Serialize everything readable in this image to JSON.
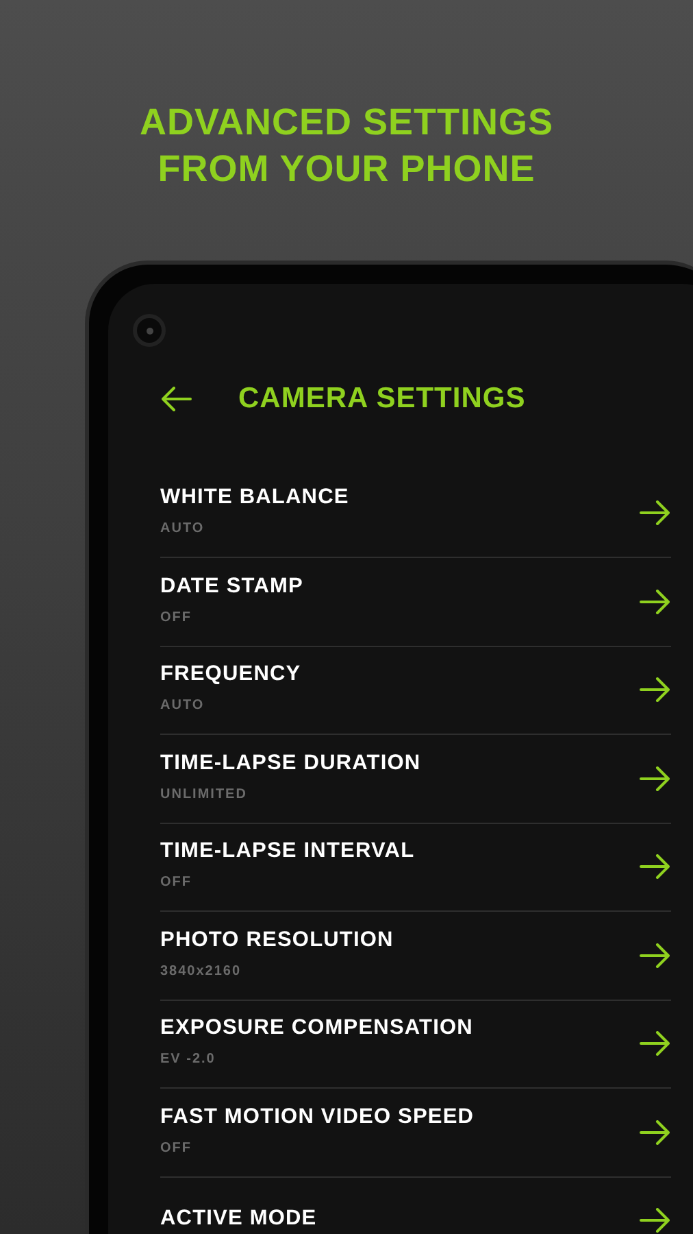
{
  "headline": [
    "ADVANCED SETTINGS",
    "FROM YOUR PHONE"
  ],
  "screen": {
    "title": "CAMERA SETTINGS",
    "items": [
      {
        "title": "WHITE BALANCE",
        "value": "AUTO"
      },
      {
        "title": "DATE STAMP",
        "value": "OFF"
      },
      {
        "title": "FREQUENCY",
        "value": "AUTO"
      },
      {
        "title": "TIME-LAPSE DURATION",
        "value": "UNLIMITED"
      },
      {
        "title": "TIME-LAPSE INTERVAL",
        "value": "OFF"
      },
      {
        "title": "PHOTO RESOLUTION",
        "value": "3840x2160"
      },
      {
        "title": "EXPOSURE COMPENSATION",
        "value": "EV -2.0"
      },
      {
        "title": "FAST MOTION VIDEO SPEED",
        "value": "OFF"
      },
      {
        "title": "ACTIVE MODE"
      }
    ]
  }
}
